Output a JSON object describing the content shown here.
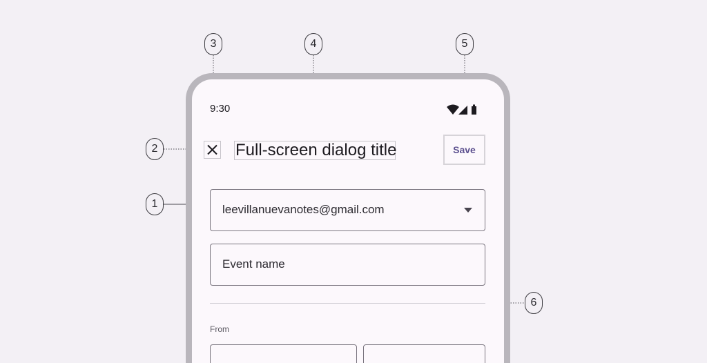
{
  "status_bar": {
    "time": "9:30",
    "icons": [
      "wifi-icon",
      "signal-icon",
      "battery-icon"
    ]
  },
  "app_bar": {
    "close_icon": "close-icon",
    "title": "Full-screen dialog title",
    "save_label": "Save"
  },
  "form": {
    "account_value": "leevillanuevanotes@gmail.com",
    "event_name_placeholder": "Event name",
    "from_label": "From"
  },
  "callouts": [
    "1",
    "2",
    "3",
    "4",
    "5",
    "6"
  ],
  "colors": {
    "background": "#F3F0F5",
    "dialog_surface": "#FCF8FC",
    "device_frame": "#B9B6BC",
    "outline": "#79747E",
    "accent": "#5B4F8E"
  }
}
